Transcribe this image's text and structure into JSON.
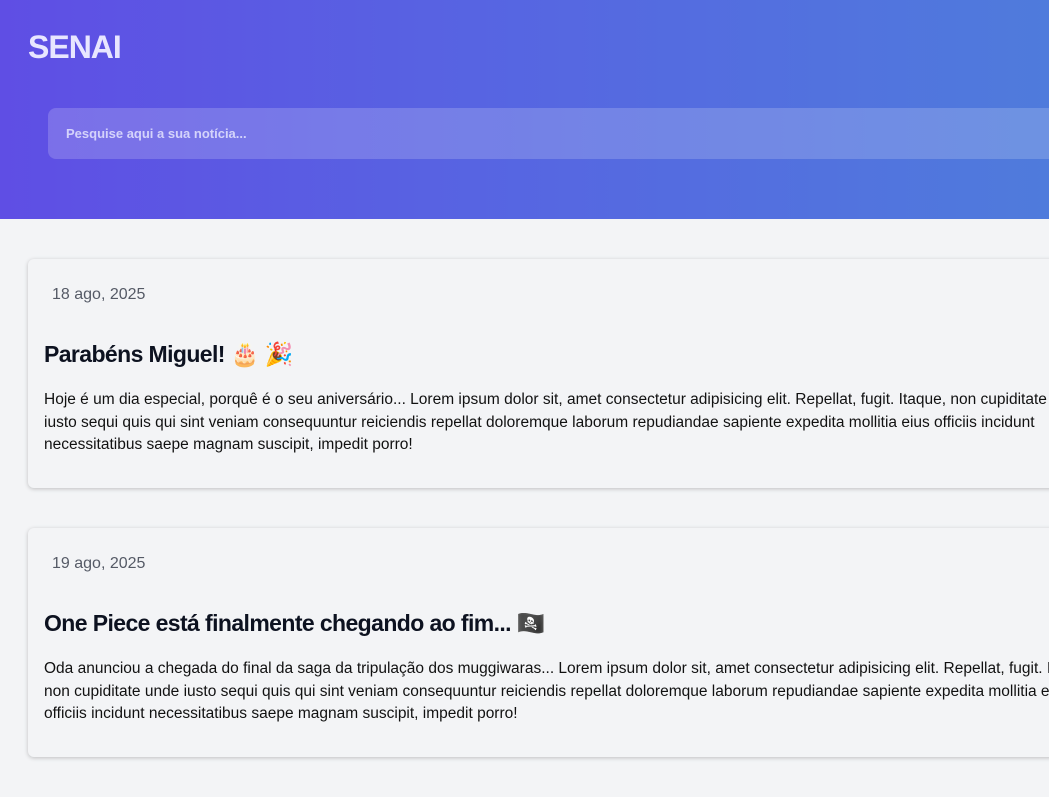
{
  "brand": {
    "name": "SENAI"
  },
  "search": {
    "placeholder": "Pesquise aqui a sua notícia..."
  },
  "posts": [
    {
      "date": "18 ago, 2025",
      "title": "Parabéns Miguel! 🎂 🎉",
      "body": "Hoje é um dia especial, porquê é o seu aniversário... Lorem ipsum dolor sit, amet consectetur adipisicing elit. Repellat, fugit. Itaque, non cupiditate unde iusto sequi quis qui sint veniam consequuntur reiciendis repellat doloremque laborum repudiandae sapiente expedita mollitia eius officiis incidunt necessitatibus saepe magnam suscipit, impedit porro!"
    },
    {
      "date": "19 ago, 2025",
      "title": "One Piece está finalmente chegando ao fim... 🏴‍☠️",
      "body": "Oda anunciou a chegada do final da saga da tripulação dos muggiwaras... Lorem ipsum dolor sit, amet consectetur adipisicing elit. Repellat, fugit. Itaque, non cupiditate unde iusto sequi quis qui sint veniam consequuntur reiciendis repellat doloremque laborum repudiandae sapiente expedita mollitia eius officiis incidunt necessitatibus saepe magnam suscipit, impedit porro!"
    }
  ]
}
